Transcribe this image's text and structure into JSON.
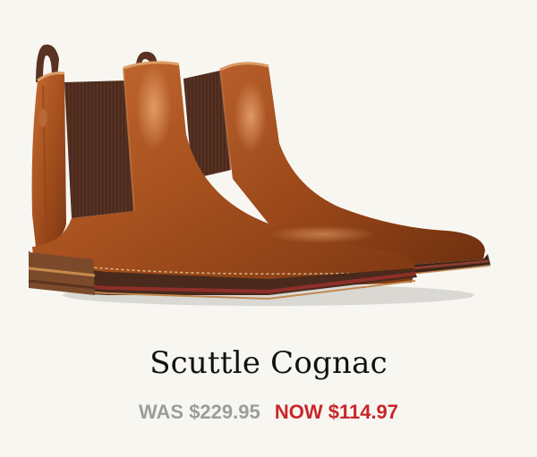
{
  "product": {
    "image_alt": "Scuttle Cognac chelsea boots",
    "name": "Scuttle Cognac",
    "was_price": "WAS $229.95",
    "now_price": "NOW $114.97"
  },
  "colors": {
    "background": "#f8f6f1",
    "leather": "#a8521f",
    "elastic": "#4a2a1e",
    "sale_price": "#c8262b",
    "was_price": "#9c9c9c"
  }
}
